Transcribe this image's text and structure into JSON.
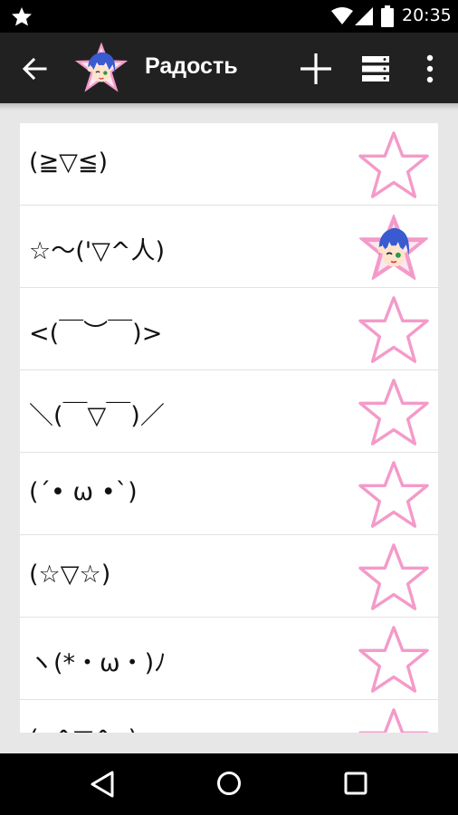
{
  "status_bar": {
    "time": "20:35",
    "icons": [
      "notification-star-icon",
      "wifi-icon",
      "cell-signal-icon",
      "battery-icon"
    ]
  },
  "toolbar": {
    "title": "Радость",
    "icons": [
      "back-arrow-icon",
      "category-avatar",
      "add-icon",
      "list-view-icon",
      "overflow-menu-icon"
    ]
  },
  "colors": {
    "toolbar_bg": "#212121",
    "star_outline": "#f49ac9",
    "list_bg": "#ffffff",
    "page_bg": "#e7e7e7"
  },
  "items": [
    {
      "emoticon": "(≧▽≦)",
      "favorite": false
    },
    {
      "emoticon": "☆～('▽^人)",
      "favorite": true
    },
    {
      "emoticon": "<(￣︶￣)>",
      "favorite": false
    },
    {
      "emoticon": "＼(￣▽￣)／",
      "favorite": false
    },
    {
      "emoticon": "(´• ω •`)",
      "favorite": false
    },
    {
      "emoticon": "(☆▽☆)",
      "favorite": false
    },
    {
      "emoticon": "ヽ(*・ω・)ﾉ",
      "favorite": false
    },
    {
      "emoticon": "(o^▽^o)",
      "favorite": false
    }
  ],
  "nav_bar": {
    "icons": [
      "nav-back-icon",
      "nav-home-icon",
      "nav-recents-icon"
    ]
  }
}
